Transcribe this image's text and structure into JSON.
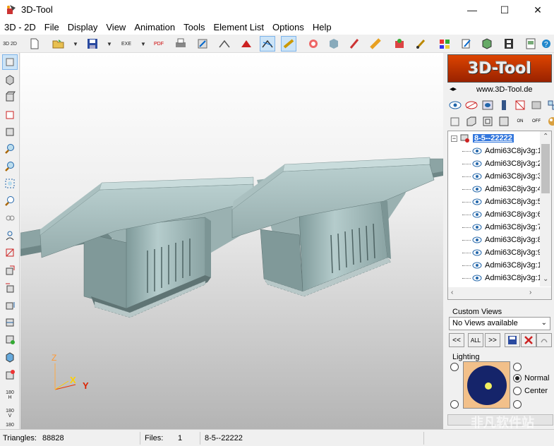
{
  "window": {
    "title": "3D-Tool",
    "minimize": "—",
    "maximize": "☐",
    "close": "✕"
  },
  "menu": [
    "3D - 2D",
    "File",
    "Display",
    "View",
    "Animation",
    "Tools",
    "Element List",
    "Options",
    "Help"
  ],
  "toolbar": {
    "items": [
      "3d-2d-button",
      "new-file-icon",
      "open-folder-icon",
      "save-icon",
      "exe-icon",
      "pdf-icon",
      "print-icon",
      "export-icon",
      "view-icon",
      "cut-icon",
      "section-icon",
      "measure-icon",
      "settings-icon",
      "object-icon",
      "pen-icon",
      "ruler-icon",
      "tools-icon",
      "brush-icon",
      "color-icon",
      "edit-icon",
      "cube-icon",
      "film-icon",
      "page-icon",
      "help-icon"
    ],
    "labels": {
      "exe": "EXE",
      "pdf": "PDF",
      "three_d": "3D 2D"
    }
  },
  "left_toolbar": {
    "buttons": [
      "select-icon",
      "iso-view-icon",
      "front-view-icon",
      "box-view-icon",
      "pan-icon",
      "zoom-in-icon",
      "zoom-out-icon",
      "zoom-fit-icon",
      "zoom-window-icon",
      "orbit-icon",
      "walk-icon",
      "section-icon",
      "rotate-x-icon",
      "rotate-y-icon",
      "rotate-z-icon",
      "flip-icon",
      "cube-view-icon",
      "perspective-icon"
    ],
    "rot_h": "180\nH",
    "rot_v": "180\nV",
    "rot_last": "180"
  },
  "axes": {
    "x": "X",
    "y": "Y",
    "z": "Z"
  },
  "right_panel": {
    "logo": "3D-Tool",
    "website": "www.3D-Tool.de",
    "on_label": "ON",
    "off_label": "OFF",
    "tree": {
      "root": "8-5--22222",
      "items": [
        "Admi63C8jv3g:1",
        "Admi63C8jv3g:2",
        "Admi63C8jv3g:3",
        "Admi63C8jv3g:4",
        "Admi63C8jv3g:5",
        "Admi63C8jv3g:6",
        "Admi63C8jv3g:7",
        "Admi63C8jv3g:8",
        "Admi63C8jv3g:9",
        "Admi63C8jv3g:1",
        "Admi63C8jv3g:1"
      ]
    },
    "custom_views": {
      "label": "Custom Views",
      "selected": "No Views available",
      "prev": "<<",
      "all": "ALL",
      "next": ">>"
    },
    "lighting": {
      "label": "Lighting",
      "normal": "Normal",
      "center": "Center"
    }
  },
  "status": {
    "triangles_label": "Triangles:",
    "triangles_value": "88828",
    "files_label": "Files:",
    "files_value": "1",
    "file_name": "8-5--22222"
  },
  "watermark": "非凡软件站"
}
